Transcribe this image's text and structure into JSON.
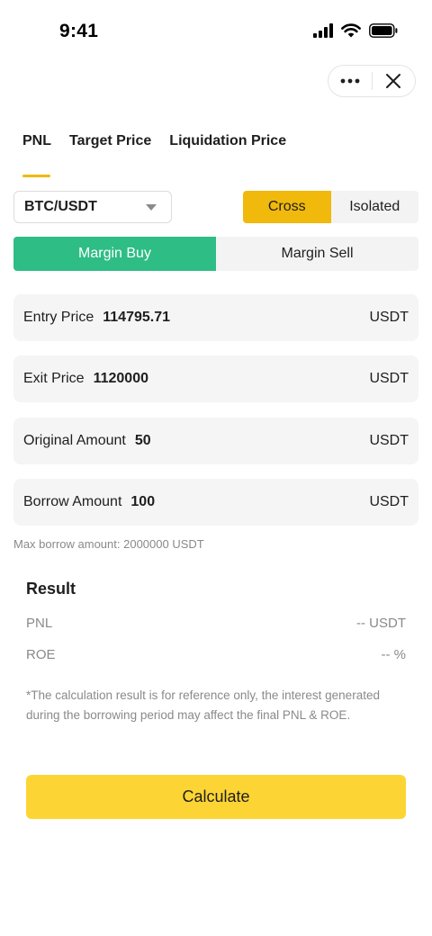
{
  "status_bar": {
    "time": "9:41"
  },
  "tabs": [
    {
      "label": "PNL",
      "active": true
    },
    {
      "label": "Target Price",
      "active": false
    },
    {
      "label": "Liquidation Price",
      "active": false
    }
  ],
  "pair": {
    "value": "BTC/USDT"
  },
  "mode": {
    "cross": "Cross",
    "isolated": "Isolated",
    "selected": "Cross"
  },
  "side": {
    "buy": "Margin Buy",
    "sell": "Margin Sell",
    "selected": "Margin Buy"
  },
  "fields": {
    "entry": {
      "label": "Entry Price",
      "value": "114795.71",
      "unit": "USDT"
    },
    "exit": {
      "label": "Exit Price",
      "value": "1120000",
      "unit": "USDT"
    },
    "original": {
      "label": "Original Amount",
      "value": "50",
      "unit": "USDT"
    },
    "borrow": {
      "label": "Borrow Amount",
      "value": "100",
      "unit": "USDT"
    }
  },
  "hint": "Max borrow amount: 2000000 USDT",
  "result": {
    "title": "Result",
    "pnl_label": "PNL",
    "pnl_value": "-- USDT",
    "roe_label": "ROE",
    "roe_value": "-- %"
  },
  "note": "*The calculation result is for reference only, the interest generated during the borrowing period may affect the final PNL & ROE.",
  "calculate_label": "Calculate",
  "colors": {
    "accent": "#f0b90b",
    "buy": "#2ebd85",
    "button": "#fcd535"
  }
}
